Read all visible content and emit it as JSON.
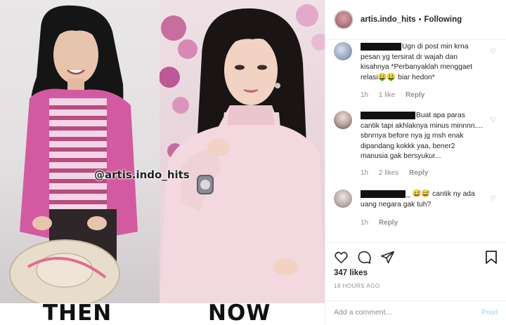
{
  "post": {
    "watermark": "@artis.indo_hits",
    "caption_then": "THEN",
    "caption_now": "NOW"
  },
  "header": {
    "username": "artis.indo_hits",
    "separator": "•",
    "follow_status": "Following",
    "more_label": "···"
  },
  "comments": [
    {
      "text": "Ugn di post min krna pesan yg tersirat dr wajah dan kisahnya *Perbanyaklah menggaet relasi🤑🤑 biar hedon*",
      "time": "1h",
      "likes": "1 like",
      "reply": "Reply"
    },
    {
      "text": "Buat apa paras cantik tapi akhlaknya minus minnnn.... sbnrnya before nya jg msh enak dipandang kokkk yaa, bener2 manusia gak bersyukur...",
      "time": "1h",
      "likes": "2 likes",
      "reply": "Reply"
    },
    {
      "text": "_ 😅😅 cantik ny ada uang negara gak tuh?",
      "time": "1h",
      "likes": "",
      "reply": "Reply"
    }
  ],
  "actions": {
    "likes": "347 likes",
    "timestamp": "18 HOURS AGO",
    "add_comment_placeholder": "Add a comment...",
    "post_label": "Post"
  },
  "colors": {
    "then_top": "#d35aa1",
    "then_stripe": "#b84c82",
    "now_sweater": "#f3d9df",
    "post_button": "#b2dffc"
  }
}
